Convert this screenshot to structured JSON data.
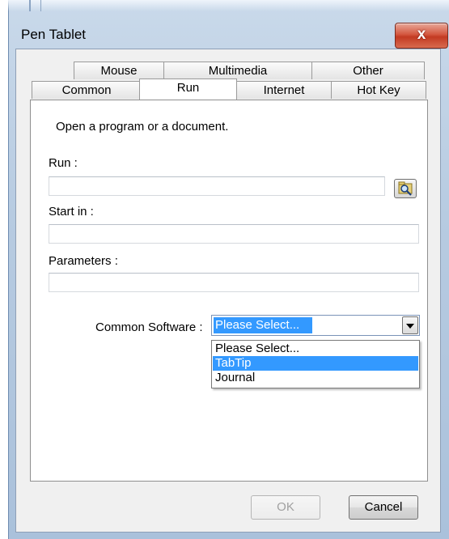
{
  "window": {
    "title": "Pen Tablet",
    "close_label": "x"
  },
  "tabs": {
    "row1": [
      "Mouse",
      "Multimedia",
      "Other"
    ],
    "row2": [
      "Common",
      "Run",
      "Internet",
      "Hot Key"
    ],
    "active": "Run"
  },
  "run_tab": {
    "description": "Open a program or a document.",
    "run_label": "Run :",
    "run_value": "",
    "browse_icon": "browse-folder-icon",
    "start_in_label": "Start in :",
    "start_in_value": "",
    "parameters_label": "Parameters :",
    "parameters_value": "",
    "common_software_label": "Common Software :",
    "common_software_selected": "Please Select...",
    "common_software_options": [
      "Please Select...",
      "TabTip",
      "Journal"
    ],
    "highlighted_option": "TabTip"
  },
  "buttons": {
    "ok": "OK",
    "cancel": "Cancel"
  },
  "colors": {
    "selection": "#3399ff",
    "close_button": "#c23a22"
  }
}
